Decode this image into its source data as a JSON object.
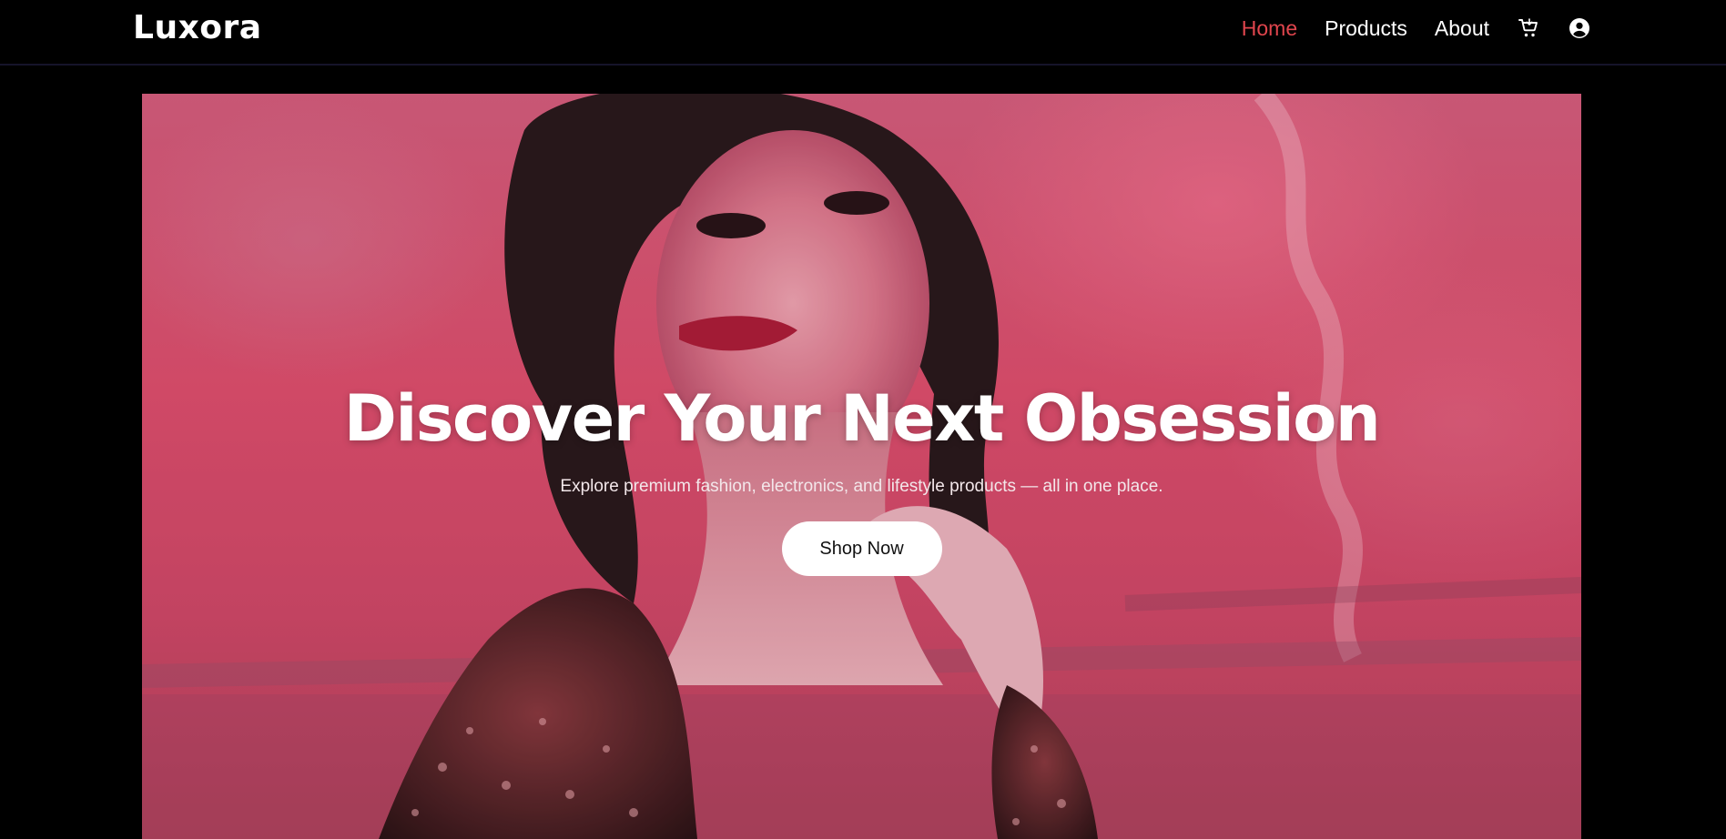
{
  "brand": {
    "name": "Luxora"
  },
  "nav": {
    "links": [
      {
        "label": "Home",
        "active": true
      },
      {
        "label": "Products",
        "active": false
      },
      {
        "label": "About",
        "active": false
      }
    ],
    "icons": [
      "cart-icon",
      "user-account-icon"
    ],
    "active_color": "#e0454d"
  },
  "hero": {
    "title": "Discover Your Next Obsession",
    "subtitle": "Explore premium fashion, electronics, and lifestyle products — all in one place.",
    "cta_label": "Shop Now",
    "background_image": "fashion-portrait-photo"
  },
  "colors": {
    "background": "#000000",
    "text": "#ffffff",
    "accent": "#e0454d",
    "hero_tint": "#e2506f"
  }
}
